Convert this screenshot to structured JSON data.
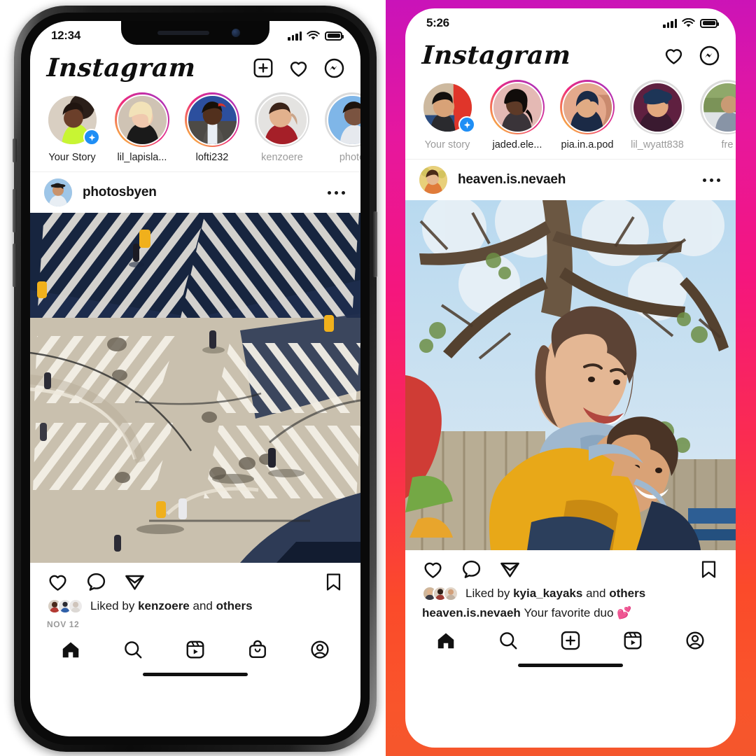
{
  "meta": {
    "layout": "side-by-side phone mockups of the Instagram feed",
    "accent_gradient_start": "#c913b9",
    "accent_gradient_end": "#f4562c",
    "story_ring_gradient": [
      "#f9ce34",
      "#ee2a7b",
      "#a033c8"
    ],
    "add_badge_color": "#1f8ef5"
  },
  "left_phone": {
    "frame": "dark-hardware-bezel",
    "status_bar": {
      "time": "12:34",
      "cellular_icon": "signal-bars-icon",
      "wifi_icon": "wifi-icon",
      "battery_icon": "battery-full-icon"
    },
    "header": {
      "logo": "Instagram",
      "icons": [
        {
          "name": "new-post-icon",
          "glyph": "plus-box"
        },
        {
          "name": "activity-heart-icon",
          "glyph": "heart"
        },
        {
          "name": "messenger-icon",
          "glyph": "messenger"
        }
      ]
    },
    "stories": [
      {
        "label": "Your Story",
        "ring": "none",
        "dim": false,
        "has_add_badge": true
      },
      {
        "label": "lil_lapisla...",
        "ring": "active",
        "dim": false,
        "has_add_badge": false
      },
      {
        "label": "lofti232",
        "ring": "active",
        "dim": false,
        "has_add_badge": false
      },
      {
        "label": "kenzoere",
        "ring": "seen",
        "dim": true,
        "has_add_badge": false
      },
      {
        "label": "photo",
        "ring": "seen",
        "dim": true,
        "has_add_badge": false
      }
    ],
    "post": {
      "username": "photosbyen",
      "more_options": "post-options-icon",
      "image_alt": "aerial view of a city crosswalk intersection with diagonal white stripes",
      "actions": [
        {
          "name": "like-icon"
        },
        {
          "name": "comment-icon"
        },
        {
          "name": "share-icon"
        },
        {
          "name": "save-icon"
        }
      ],
      "liked_by_prefix": "Liked by",
      "liked_by_user": "kenzoere",
      "liked_by_suffix_and": "and",
      "liked_by_others": "others",
      "timestamp": "NOV 12",
      "caption": ""
    },
    "tab_bar": [
      {
        "name": "tab-home",
        "glyph": "home",
        "active": true
      },
      {
        "name": "tab-search",
        "glyph": "search",
        "active": false
      },
      {
        "name": "tab-reels",
        "glyph": "reels",
        "active": false
      },
      {
        "name": "tab-shop",
        "glyph": "shop",
        "active": false
      },
      {
        "name": "tab-profile",
        "glyph": "profile",
        "active": false
      }
    ]
  },
  "right_phone": {
    "frame": "instagram-gradient-frame",
    "status_bar": {
      "time": "5:26",
      "cellular_icon": "signal-bars-icon",
      "wifi_icon": "wifi-icon",
      "battery_icon": "battery-full-icon"
    },
    "header": {
      "logo": "Instagram",
      "icons": [
        {
          "name": "activity-heart-icon",
          "glyph": "heart"
        },
        {
          "name": "messenger-icon",
          "glyph": "messenger"
        }
      ]
    },
    "stories": [
      {
        "label": "Your story",
        "ring": "none",
        "dim": true,
        "has_add_badge": true
      },
      {
        "label": "jaded.ele...",
        "ring": "active",
        "dim": false,
        "has_add_badge": false
      },
      {
        "label": "pia.in.a.pod",
        "ring": "active",
        "dim": false,
        "has_add_badge": false
      },
      {
        "label": "lil_wyatt838",
        "ring": "seen",
        "dim": true,
        "has_add_badge": false
      },
      {
        "label": "fre",
        "ring": "seen",
        "dim": true,
        "has_add_badge": false
      }
    ],
    "post": {
      "username": "heaven.is.nevaeh",
      "more_options": "post-options-icon",
      "image_alt": "two smiling people piggyback riding outdoors under a large tree",
      "actions": [
        {
          "name": "like-icon"
        },
        {
          "name": "comment-icon"
        },
        {
          "name": "share-icon"
        },
        {
          "name": "save-icon"
        }
      ],
      "liked_by_prefix": "Liked by",
      "liked_by_user": "kyia_kayaks",
      "liked_by_suffix_and": "and",
      "liked_by_others": "others",
      "caption_user": "heaven.is.nevaeh",
      "caption_text": "Your favorite duo 💕",
      "timestamp": ""
    },
    "tab_bar": [
      {
        "name": "tab-home",
        "glyph": "home",
        "active": true
      },
      {
        "name": "tab-search",
        "glyph": "search",
        "active": false
      },
      {
        "name": "tab-create",
        "glyph": "plus-box",
        "active": false
      },
      {
        "name": "tab-reels",
        "glyph": "reels",
        "active": false
      },
      {
        "name": "tab-profile",
        "glyph": "profile",
        "active": false
      }
    ]
  }
}
